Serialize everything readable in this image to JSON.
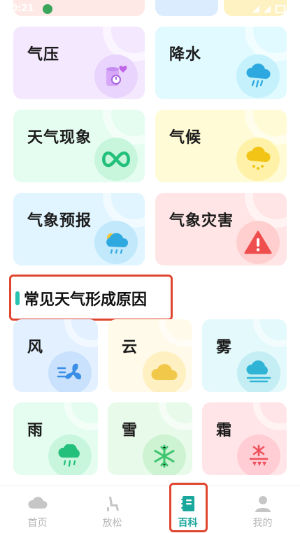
{
  "status_bar": {
    "time": "0:21"
  },
  "categories": [
    {
      "title": "气压",
      "icon": "barometer-icon"
    },
    {
      "title": "降水",
      "icon": "rain-cloud-icon"
    },
    {
      "title": "天气现象",
      "icon": "infinity-cloud-icon"
    },
    {
      "title": "气候",
      "icon": "snow-cloud-icon"
    },
    {
      "title": "气象预报",
      "icon": "forecast-cloud-icon"
    },
    {
      "title": "气象灾害",
      "icon": "warning-icon"
    }
  ],
  "section": {
    "title": "常见天气形成原因"
  },
  "causes": [
    {
      "title": "风",
      "icon": "fan-icon"
    },
    {
      "title": "云",
      "icon": "cloud-icon"
    },
    {
      "title": "雾",
      "icon": "fog-icon"
    },
    {
      "title": "雨",
      "icon": "rain-icon"
    },
    {
      "title": "雪",
      "icon": "snowflake-icon"
    },
    {
      "title": "霜",
      "icon": "frost-icon"
    }
  ],
  "tabbar": {
    "items": [
      {
        "label": "首页",
        "icon": "cloud-home-icon"
      },
      {
        "label": "放松",
        "icon": "seat-icon"
      },
      {
        "label": "百科",
        "icon": "book-icon"
      },
      {
        "label": "我的",
        "icon": "person-icon"
      }
    ],
    "active_index": 2
  },
  "colors": {
    "accent": "#1aa79c",
    "highlight_box": "#e0452f",
    "inactive": "#b5b5b5"
  }
}
